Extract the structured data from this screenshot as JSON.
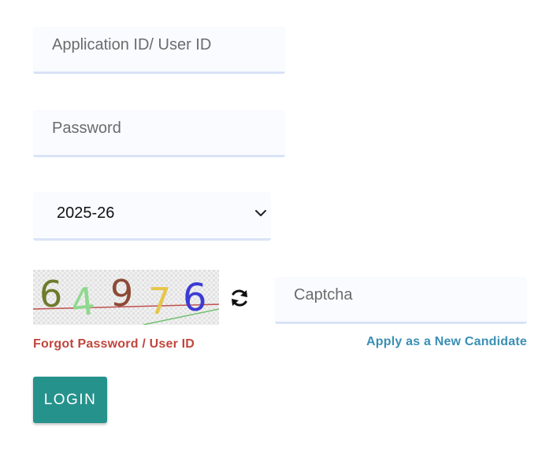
{
  "form": {
    "userid_placeholder": "Application ID/ User ID",
    "password_placeholder": "Password",
    "year_selected": "2025-26",
    "captcha_placeholder": "Captcha",
    "captcha_text": "64976",
    "forgot_label": "Forgot Password / User ID",
    "apply_label": "Apply as a New Candidate",
    "login_label": "LOGIN"
  },
  "colors": {
    "login_button": "#26928c",
    "forgot_link": "#c0463d",
    "apply_link": "#3a8fb5",
    "field_background": "#f9fbff",
    "field_underline": "#d9e3f6"
  },
  "icons": {
    "refresh": "refresh-icon",
    "dropdown": "chevron-down-icon"
  }
}
